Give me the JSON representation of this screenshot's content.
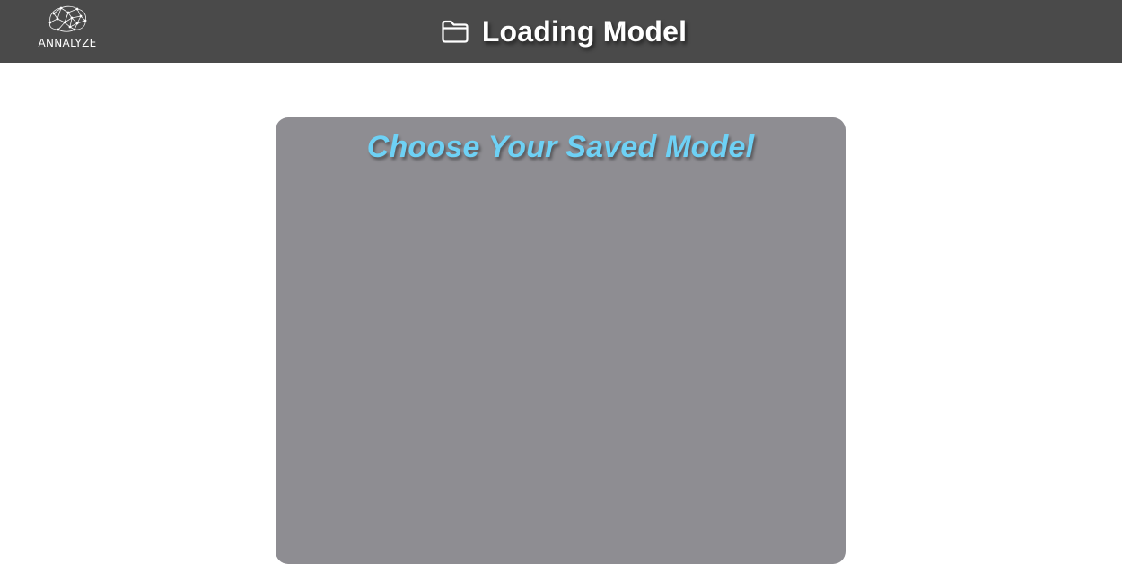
{
  "header": {
    "logo_text": "ANNALYZE",
    "logo_icon": "brain-network-icon",
    "title_icon": "folder-icon",
    "title": "Loading Model",
    "background_color": "#4a4a4a"
  },
  "panel": {
    "title": "Choose Your Saved Model",
    "title_color": "#6ed1f5",
    "background_color": "#8e8d92",
    "models": []
  }
}
